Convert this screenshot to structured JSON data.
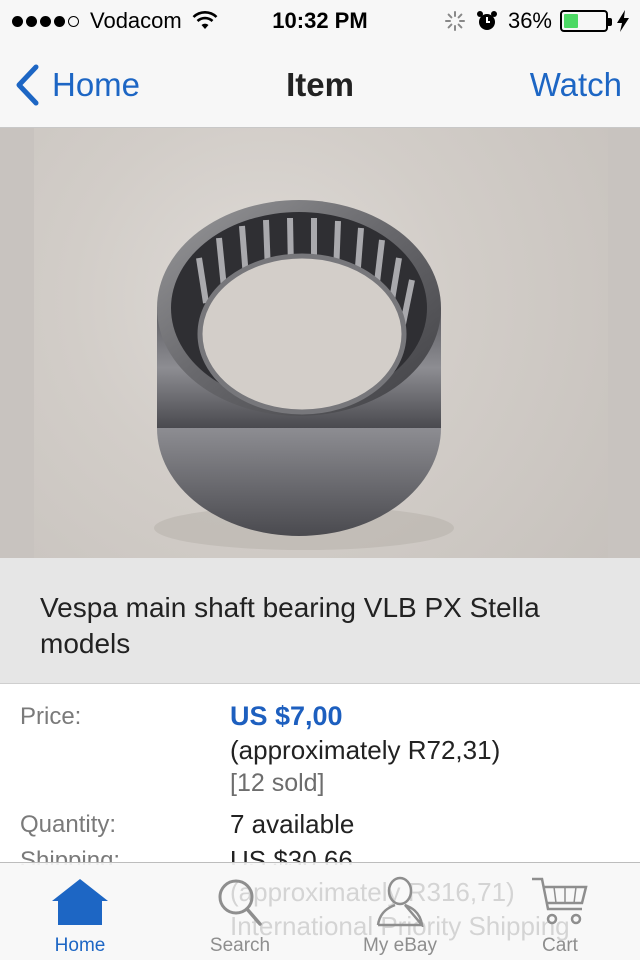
{
  "status_bar": {
    "carrier": "Vodacom",
    "time": "10:32 PM",
    "battery": "36%",
    "battery_level": 0.36,
    "signal_bars": 4
  },
  "nav": {
    "back_label": "Home",
    "title": "Item",
    "watch_label": "Watch"
  },
  "item": {
    "title": "Vespa main shaft bearing VLB PX Stella models"
  },
  "details": {
    "price_label": "Price:",
    "price": "US $7,00",
    "price_approx": "(approximately R72,31)",
    "sold": "[12 sold]",
    "quantity_label": "Quantity:",
    "quantity": "7 available",
    "shipping_label": "Shipping:",
    "shipping": "US $30,66",
    "shipping_approx": "(approximately R316,71)",
    "shipping_method": "International Priority Shipping"
  },
  "tabs": [
    {
      "label": "Home",
      "icon": "home-icon",
      "active": true
    },
    {
      "label": "Search",
      "icon": "search-icon",
      "active": false
    },
    {
      "label": "My eBay",
      "icon": "user-icon",
      "active": false
    },
    {
      "label": "Cart",
      "icon": "cart-icon",
      "active": false
    }
  ],
  "colors": {
    "accent": "#1d66c4",
    "price": "#1d5fbf",
    "battery": "#4cd964"
  }
}
